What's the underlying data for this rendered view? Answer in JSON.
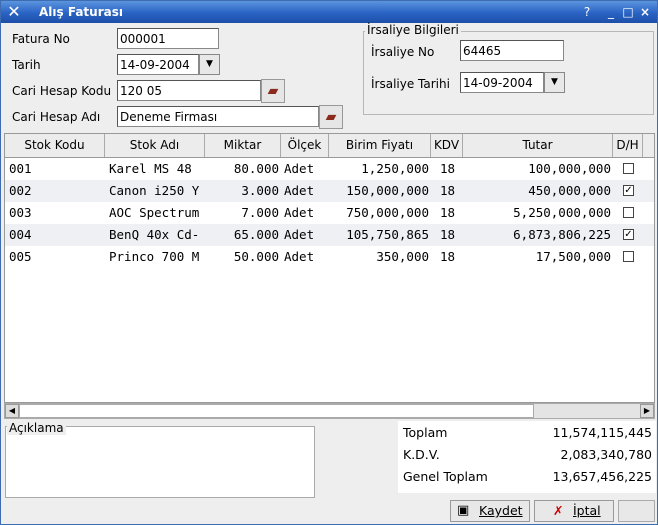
{
  "window": {
    "title": "Alış Faturası",
    "controls": [
      "?",
      "_",
      "□",
      "×"
    ]
  },
  "form": {
    "fatura_no_label": "Fatura No",
    "fatura_no": "000001",
    "tarih_label": "Tarih",
    "tarih": "14-09-2004",
    "cari_kodu_label": "Cari Hesap Kodu",
    "cari_kodu": "120 05",
    "cari_adi_label": "Cari Hesap Adı",
    "cari_adi": "Deneme Firması"
  },
  "irsaliye": {
    "group_title": "İrsaliye Bilgileri",
    "no_label": "İrsaliye No",
    "no": "64465",
    "tarih_label": "İrsaliye Tarihi",
    "tarih": "14-09-2004"
  },
  "table": {
    "headers": [
      "Stok Kodu",
      "Stok Adı",
      "Miktar",
      "Ölçek",
      "Birim Fiyatı",
      "KDV",
      "Tutar",
      "D/H"
    ],
    "rows": [
      {
        "kod": "001",
        "ad": "Karel MS 48",
        "miktar": "80.000",
        "olcek": "Adet",
        "fiyat": "1,250,000",
        "kdv": "18",
        "tutar": "100,000,000",
        "dh": false
      },
      {
        "kod": "002",
        "ad": "Canon i250 Y",
        "miktar": "3.000",
        "olcek": "Adet",
        "fiyat": "150,000,000",
        "kdv": "18",
        "tutar": "450,000,000",
        "dh": true
      },
      {
        "kod": "003",
        "ad": "AOC Spectrum",
        "miktar": "7.000",
        "olcek": "Adet",
        "fiyat": "750,000,000",
        "kdv": "18",
        "tutar": "5,250,000,000",
        "dh": false
      },
      {
        "kod": "004",
        "ad": "BenQ 40x Cd-",
        "miktar": "65.000",
        "olcek": "Adet",
        "fiyat": "105,750,865",
        "kdv": "18",
        "tutar": "6,873,806,225",
        "dh": true
      },
      {
        "kod": "005",
        "ad": "Princo 700 M",
        "miktar": "50.000",
        "olcek": "Adet",
        "fiyat": "350,000",
        "kdv": "18",
        "tutar": "17,500,000",
        "dh": false
      }
    ]
  },
  "aciklama": {
    "label": "Açıklama",
    "value": ""
  },
  "totals": {
    "toplam_label": "Toplam",
    "toplam": "11,574,115,445",
    "kdv_label": "K.D.V.",
    "kdv": "2,083,340,780",
    "genel_label": "Genel Toplam",
    "genel": "13,657,456,225"
  },
  "buttons": {
    "kaydet": "Kaydet",
    "iptal": "İptal"
  }
}
